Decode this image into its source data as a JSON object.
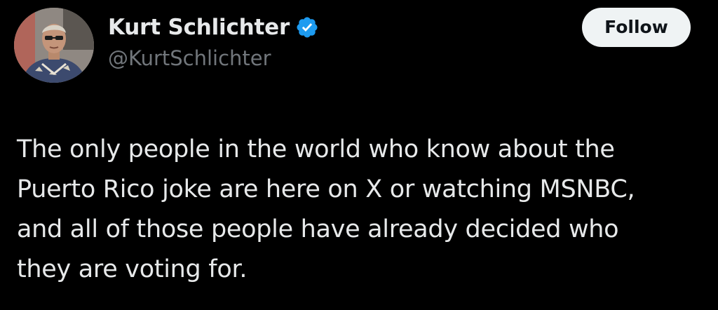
{
  "author": {
    "display_name": "Kurt Schlichter",
    "handle": "@KurtSchlichter",
    "verified": true,
    "verified_icon": "verified-badge-icon",
    "verified_color": "#1d9bf0"
  },
  "actions": {
    "follow_label": "Follow"
  },
  "tweet": {
    "lines": [
      "The only people in the world who know about the",
      "Puerto Rico joke are here on X or watching MSNBC,",
      "and all of those people have already decided who",
      "they are voting for."
    ]
  },
  "colors": {
    "background": "#000000",
    "primary_text": "#e7e9ea",
    "secondary_text": "#71767b",
    "button_bg": "#eff3f4",
    "button_text": "#0f1419"
  }
}
